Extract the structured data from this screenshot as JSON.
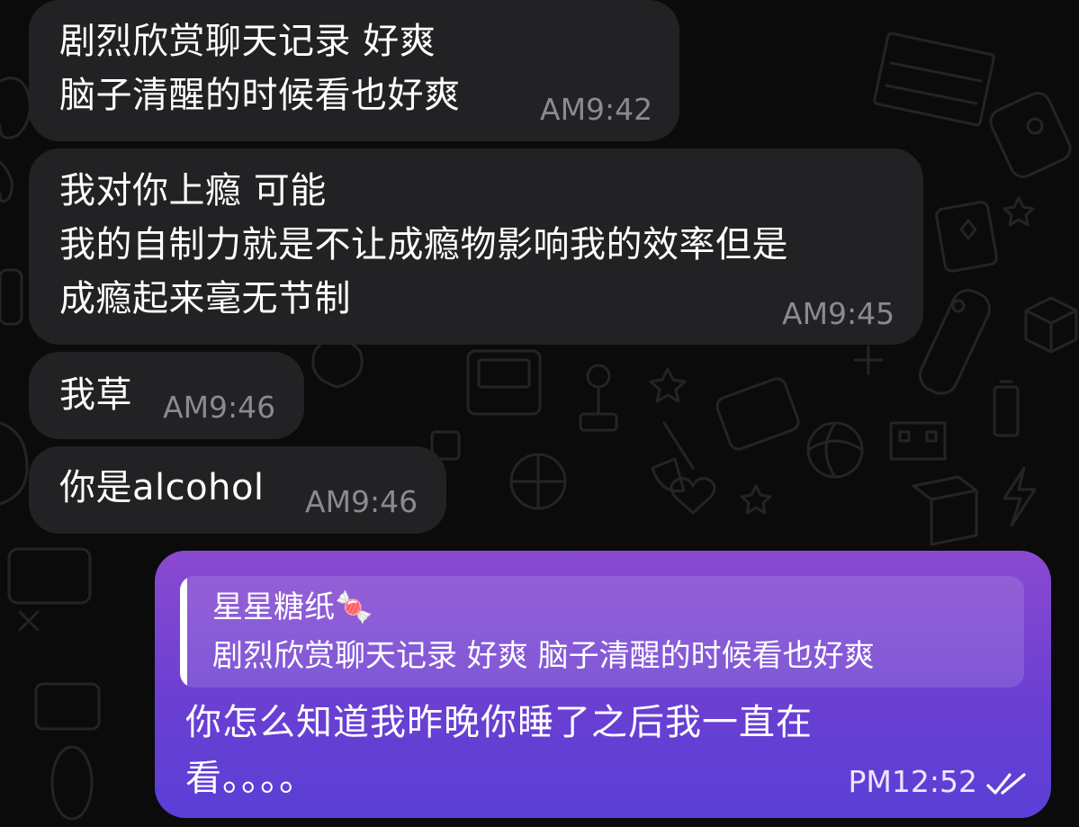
{
  "messages": [
    {
      "lines": "剧烈欣赏聊天记录 好爽\n脑子清醒的时候看也好爽",
      "time": "AM9:42"
    },
    {
      "lines": "我对你上瘾 可能\n我的自制力就是不让成瘾物影响我的效率但是\n成瘾起来毫无节制",
      "time": "AM9:45"
    },
    {
      "lines": "我草",
      "time": "AM9:46"
    },
    {
      "lines": "你是alcohol",
      "time": "AM9:46"
    }
  ],
  "outgoing": {
    "reply_name": "星星糖纸🍬",
    "reply_quote": "剧烈欣赏聊天记录 好爽 脑子清醒的时候看也好爽",
    "text": "你怎么知道我昨晚你睡了之后我一直在\n看。。。。",
    "time": "PM12:52",
    "status_icon": "double-check-icon"
  },
  "colors": {
    "background": "#0b0b0c",
    "incoming_bubble": "#222224",
    "outgoing_bubble_top": "#8a4ad0",
    "outgoing_bubble_bottom": "#5a3fd6",
    "timestamp": "#8a8a8f"
  }
}
